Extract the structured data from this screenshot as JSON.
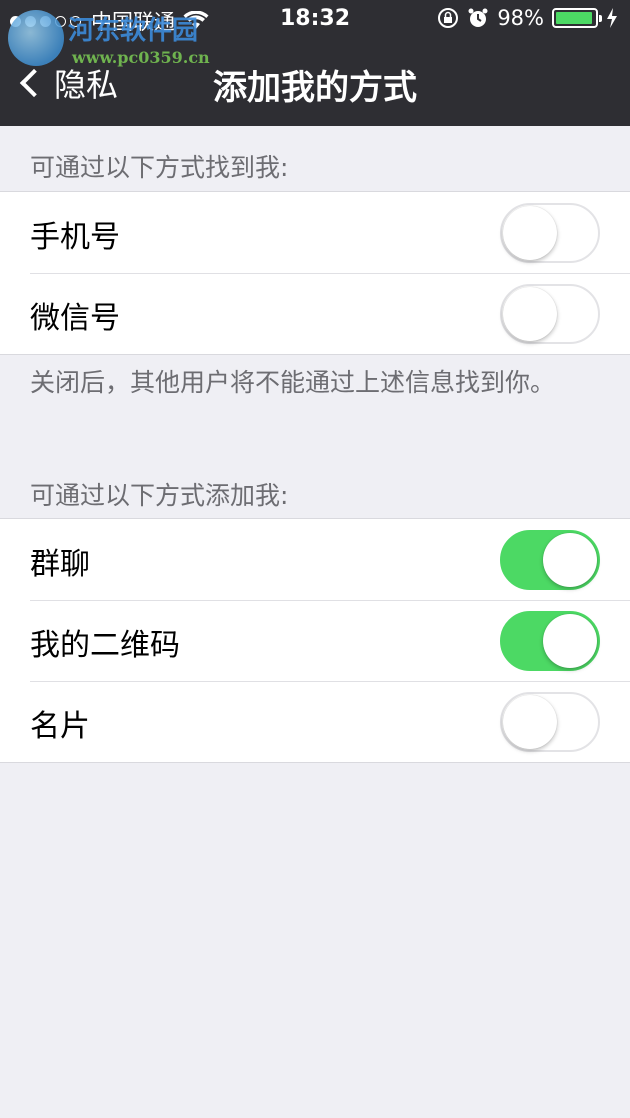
{
  "status_bar": {
    "carrier": "中国联通",
    "time": "18:32",
    "battery": "98%",
    "signal_icon": "signal-dots-icon",
    "wifi_icon": "wifi-icon",
    "lock_icon": "rotation-lock-icon",
    "alarm_icon": "alarm-icon",
    "charging_icon": "charging-bolt-icon"
  },
  "watermark": {
    "title": "河东软件园",
    "url": "www.pc0359.cn"
  },
  "nav": {
    "back_label": "隐私",
    "title": "添加我的方式"
  },
  "section1": {
    "header": "可通过以下方式找到我:",
    "rows": [
      {
        "label": "手机号",
        "enabled": false
      },
      {
        "label": "微信号",
        "enabled": false
      }
    ],
    "footer": "关闭后，其他用户将不能通过上述信息找到你。"
  },
  "section2": {
    "header": "可通过以下方式添加我:",
    "rows": [
      {
        "label": "群聊",
        "enabled": true
      },
      {
        "label": "我的二维码",
        "enabled": true
      },
      {
        "label": "名片",
        "enabled": false
      }
    ]
  },
  "colors": {
    "toggle_on": "#4cd964",
    "nav_bg": "#2e2e33",
    "page_bg": "#efeff4"
  }
}
